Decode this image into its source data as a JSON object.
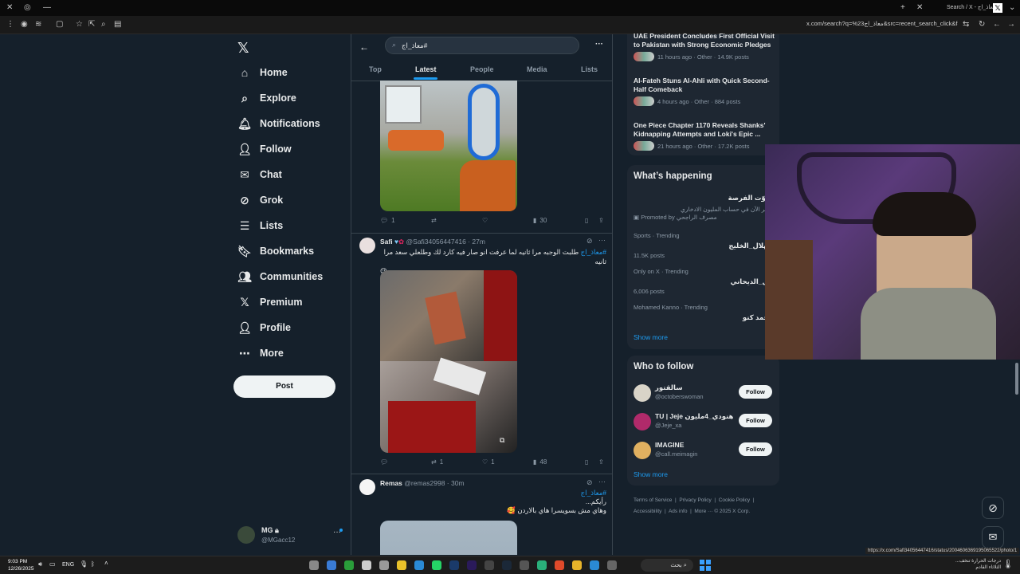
{
  "browser": {
    "tab_title": "Search / X - معاذ_اج#",
    "url": "x.com/search?q=%23معاذ_اج&src=recent_search_click&f=live",
    "status_url": "https://x.com/Safi3405644741​6/status/2004606369195065522/photo/1"
  },
  "nav": {
    "items": [
      {
        "label": "Home",
        "icon": "home-icon"
      },
      {
        "label": "Explore",
        "icon": "search-icon"
      },
      {
        "label": "Notifications",
        "icon": "bell-icon"
      },
      {
        "label": "Follow",
        "icon": "person-add-icon"
      },
      {
        "label": "Chat",
        "icon": "mail-icon"
      },
      {
        "label": "Grok",
        "icon": "grok-icon"
      },
      {
        "label": "Lists",
        "icon": "list-icon"
      },
      {
        "label": "Bookmarks",
        "icon": "bookmark-icon"
      },
      {
        "label": "Communities",
        "icon": "people-icon"
      },
      {
        "label": "Premium",
        "icon": "x-logo-icon"
      },
      {
        "label": "Profile",
        "icon": "person-icon"
      },
      {
        "label": "More",
        "icon": "more-circle-icon"
      }
    ],
    "post_label": "Post",
    "account": {
      "name": "MG",
      "handle": "@MGacc12"
    }
  },
  "search": {
    "value": "معاذ_اج#",
    "tabs": [
      "Top",
      "Latest",
      "People",
      "Media",
      "Lists"
    ],
    "active_tab": "Latest"
  },
  "tweets": [
    {
      "actions": {
        "reply": "1",
        "retweet": "",
        "like": "",
        "views": "30"
      }
    },
    {
      "name": "Safi",
      "handle": "@Safi34056447416",
      "time": "· 27m",
      "hashtag": "#معاذ_اج",
      "text": "طلبت الوجبه مرا ثانيه لما عرفت انو صار فيه كارد لك وطلعلي سعد مرا ثانيه",
      "emoji": "😉",
      "actions": {
        "reply": "",
        "retweet": "1",
        "like": "1",
        "views": "48"
      }
    },
    {
      "name": "Remas",
      "handle": "@remas2998",
      "time": "· 30m",
      "hashtag": "#معاذ_اج",
      "line2": "رأيكم...",
      "line3": "وهاي مش بسويسرا هاي بالاردن",
      "emoji": "🥰"
    }
  ],
  "right": {
    "top_trends": [
      {
        "title": "UAE President Concludes First Official Visit to Pakistan with Strong Economic Pledges",
        "meta": "11 hours ago · Other · 14.9K posts"
      },
      {
        "title": "Al-Fateh Stuns Al-Ahli with Quick Second-Half Comeback",
        "meta": "4 hours ago · Other · 884 posts"
      },
      {
        "title": "One Piece Chapter 1170 Reveals Shanks' Kidnapping Attempts and Loki's Epic ...",
        "meta": "21 hours ago · Other · 17.2K posts"
      }
    ],
    "whats_happening": {
      "heading": "What’s happening",
      "promo_title": "تفوّت الفرصة",
      "promo_text": "ادخر الآن في حساب المليون الادخاري",
      "promo_by": "Promoted by",
      "promo_sponsor": "مصرف الراجحي",
      "trends": [
        {
          "context": "Sports · Trending",
          "name": "الهلال_الخليج",
          "count": "11.5K posts"
        },
        {
          "context": "Only on X · Trending",
          "name": "هل_الديحاني",
          "count": "6,006 posts"
        },
        {
          "context": "Mohamed Kanno · Trending",
          "name": "محمد كنو",
          "count": ""
        }
      ],
      "show_more": "Show more"
    },
    "who_to_follow": {
      "heading": "Who to follow",
      "people": [
        {
          "name": "سالقتور",
          "handle": "@octoberswoman"
        },
        {
          "name": "TU | Jeje هنودي_4مليون",
          "handle": "@Jeje_xa"
        },
        {
          "name": "IMAGINE",
          "handle": "@call.meimagin"
        }
      ],
      "follow_label": "Follow",
      "show_more": "Show more"
    },
    "footer": {
      "links": [
        "Terms of Service",
        "Privacy Policy",
        "Cookie Policy",
        "Accessibility",
        "Ads info",
        "More ···"
      ],
      "copyright": "© 2025 X Corp."
    }
  },
  "taskbar": {
    "time": "9:03 PM",
    "date": "12/26/2025",
    "lang": "ENG",
    "search": "بحث",
    "weather_title": "درجات الحرارة تنخف...",
    "weather_sub": "الثلاثاء القادم"
  },
  "colors": {
    "bg": "#15202b",
    "accent": "#1d9bf0",
    "card": "#1e2732",
    "border": "#38444d"
  }
}
